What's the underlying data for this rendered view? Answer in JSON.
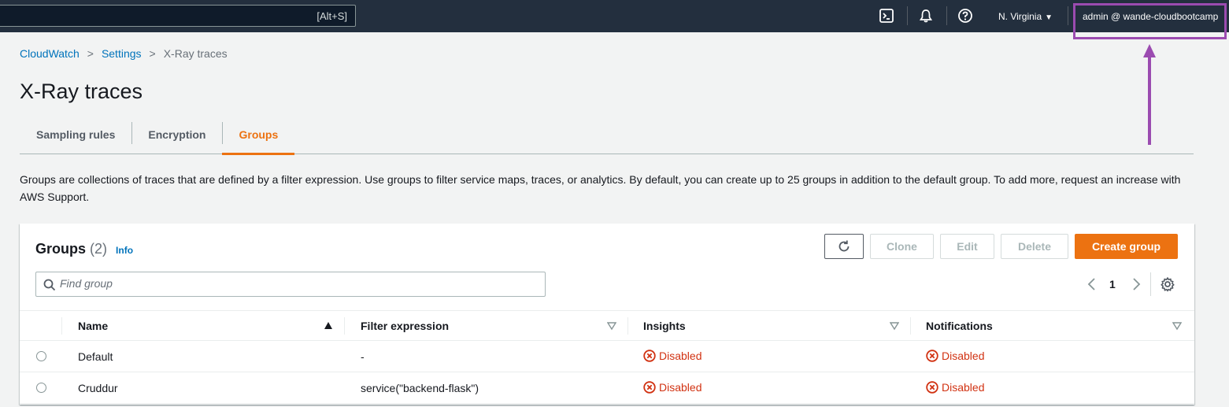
{
  "topnav": {
    "search_shortcut": "[Alt+S]",
    "icons": [
      "cloudshell-icon",
      "notifications-bell-icon",
      "help-icon"
    ],
    "region": "N. Virginia",
    "account": "admin @ wande-cloudbootcamp"
  },
  "breadcrumb": [
    {
      "label": "CloudWatch"
    },
    {
      "label": "Settings"
    },
    {
      "label": "X-Ray traces"
    }
  ],
  "page_title": "X-Ray traces",
  "tabs": [
    {
      "label": "Sampling rules",
      "active": false
    },
    {
      "label": "Encryption",
      "active": false
    },
    {
      "label": "Groups",
      "active": true
    }
  ],
  "description": "Groups are collections of traces that are defined by a filter expression. Use groups to filter service maps, traces, or analytics. By default, you can create up to 25 groups in addition to the default group. To add more, request an increase with AWS Support.",
  "groups_panel": {
    "title": "Groups",
    "count": "(2)",
    "info_link": "Info",
    "buttons": {
      "clone": "Clone",
      "edit": "Edit",
      "delete": "Delete",
      "create": "Create group"
    },
    "search_placeholder": "Find group",
    "page_number": "1",
    "columns": [
      "Name",
      "Filter expression",
      "Insights",
      "Notifications"
    ],
    "rows": [
      {
        "name": "Default",
        "filter": "-",
        "insights": "Disabled",
        "notifications": "Disabled"
      },
      {
        "name": "Cruddur",
        "filter": "service(\"backend-flask\")",
        "insights": "Disabled",
        "notifications": "Disabled"
      }
    ]
  },
  "colors": {
    "nav_bg": "#232f3e",
    "accent": "#ec7211",
    "link": "#0073bb",
    "error": "#d13212",
    "annotation": "#9b4bb0"
  }
}
